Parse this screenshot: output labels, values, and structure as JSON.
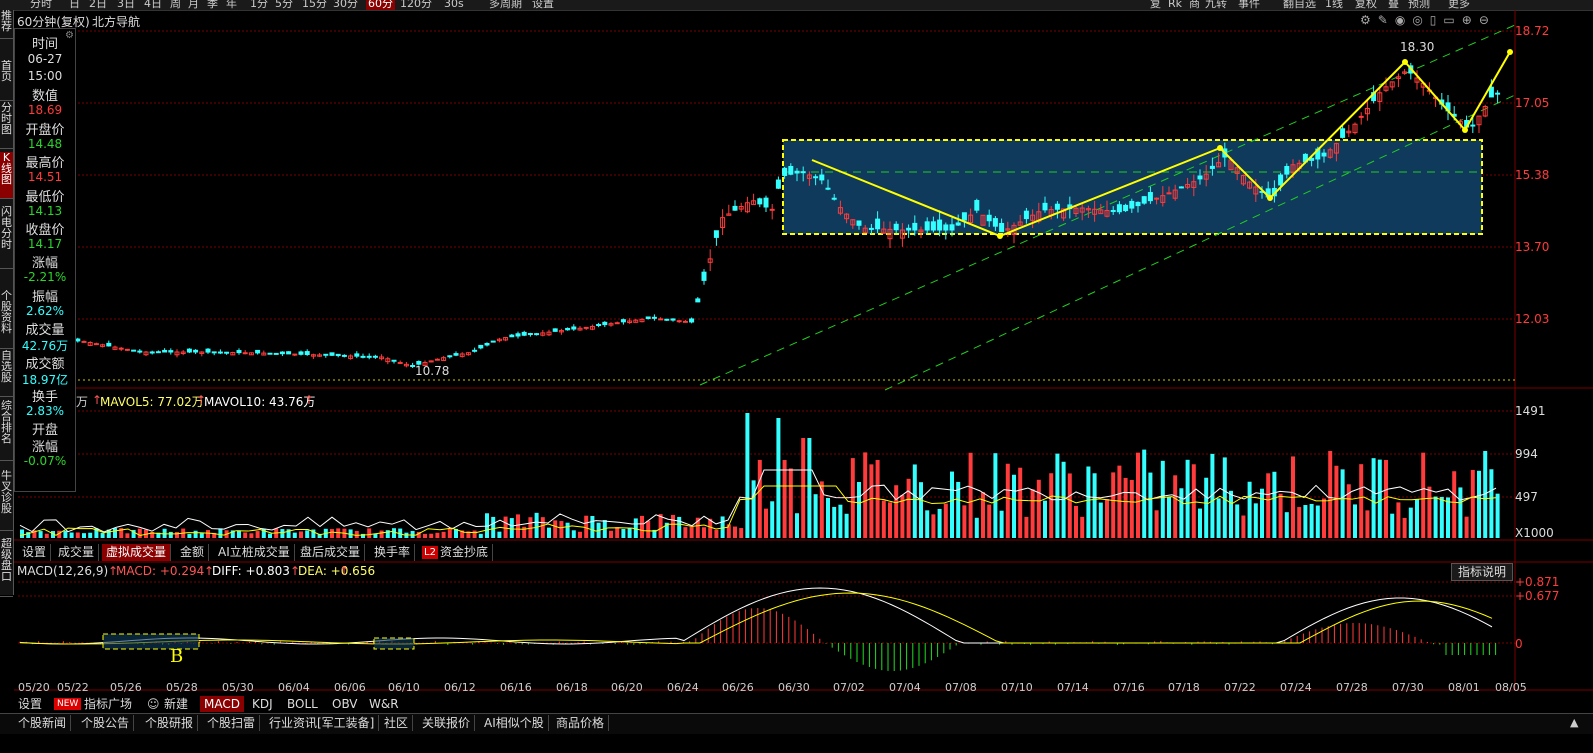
{
  "top_periods": [
    "分时",
    "日",
    "2日",
    "3日",
    "4日",
    "周",
    "月",
    "季",
    "年",
    "1分",
    "5分",
    "15分",
    "30分",
    "60分",
    "120分",
    "30s",
    "多周期",
    "设置"
  ],
  "active_period": "60分",
  "top_right_buttons": [
    "复",
    "Rk",
    "商",
    "九转",
    "事件",
    "",
    "翻自选",
    "1线",
    "复权",
    "叠",
    "预测",
    "更多"
  ],
  "sidebar_items": [
    "推荐",
    "首页",
    "分时图",
    "K线图",
    "闪电分时",
    "个股资料",
    "自选股",
    "综合排名",
    "牛叉诊股",
    "超级盘口"
  ],
  "chart_title": "60分钟(复权)",
  "stock_name": "北方导航",
  "info_panel": {
    "time_label": "时间",
    "date": "06-27",
    "time": "15:00",
    "value_label": "数值",
    "value": "18.69",
    "open_label": "开盘价",
    "open": "14.48",
    "high_label": "最高价",
    "high": "14.51",
    "low_label": "最低价",
    "low": "14.13",
    "close_label": "收盘价",
    "close": "14.17",
    "change_label": "涨幅",
    "change": "-2.21%",
    "amplitude_label": "振幅",
    "amplitude": "2.62%",
    "volume_label": "成交量",
    "volume": "42.76万",
    "turnover_label": "成交额",
    "turnover": "18.97亿",
    "turnover_rate_label": "换手",
    "turnover_rate": "2.83%",
    "open_change_label1": "开盘",
    "open_change_label2": "涨幅",
    "open_change": "-0.07%"
  },
  "price_axis": [
    "18.72",
    "17.05",
    "15.38",
    "13.70",
    "12.03"
  ],
  "annotations": {
    "high": "18.30",
    "low": "10.78",
    "b_marker": "B"
  },
  "volume_legend": {
    "prefix": "万",
    "mavol5": "MAVOL5: 77.02万",
    "mavol10": "MAVOL10: 43.76万"
  },
  "volume_axis": [
    "1491",
    "994",
    "497",
    "X1000"
  ],
  "indicator_tabs": [
    "设置",
    "成交量",
    "虚拟成交量",
    "金额",
    "AI立桩成交量",
    "盘后成交量",
    "换手率",
    "资金抄底"
  ],
  "active_indicator_tab": "虚拟成交量",
  "l2_badge": "L2",
  "macd_legend": {
    "name": "MACD(12,26,9)",
    "macd": "MACD: +0.294",
    "diff": "DIFF: +0.803",
    "dea": "DEA: +0.656"
  },
  "macd_axis": [
    "+0.871",
    "+0.677",
    "0"
  ],
  "indicator_help": "指标说明",
  "dates": [
    "05/20",
    "05/22",
    "05/26",
    "05/28",
    "05/30",
    "06/04",
    "06/06",
    "06/10",
    "06/12",
    "06/16",
    "06/18",
    "06/20",
    "06/24",
    "06/26",
    "06/30",
    "07/02",
    "07/04",
    "07/08",
    "07/10",
    "07/14",
    "07/16",
    "07/18",
    "07/22",
    "07/24",
    "07/28",
    "07/30",
    "08/01",
    "08/05"
  ],
  "bottom_tabs": [
    "设置",
    "指标广场",
    "新建",
    "MACD",
    "KDJ",
    "BOLL",
    "OBV",
    "W&R"
  ],
  "new_badge": "NEW",
  "active_bottom_tab": "MACD",
  "news_tabs": [
    "个股新闻",
    "个股公告",
    "个股研报",
    "个股扫雷",
    "行业资讯[军工装备]",
    "社区",
    "关联报价",
    "AI相似个股",
    "商品价格"
  ],
  "colors": {
    "up": "#ff3b3b",
    "down": "#3ff",
    "accent_yellow": "#ffff00",
    "trend_green": "#22cc22",
    "box_fill": "#0f3a5c"
  }
}
